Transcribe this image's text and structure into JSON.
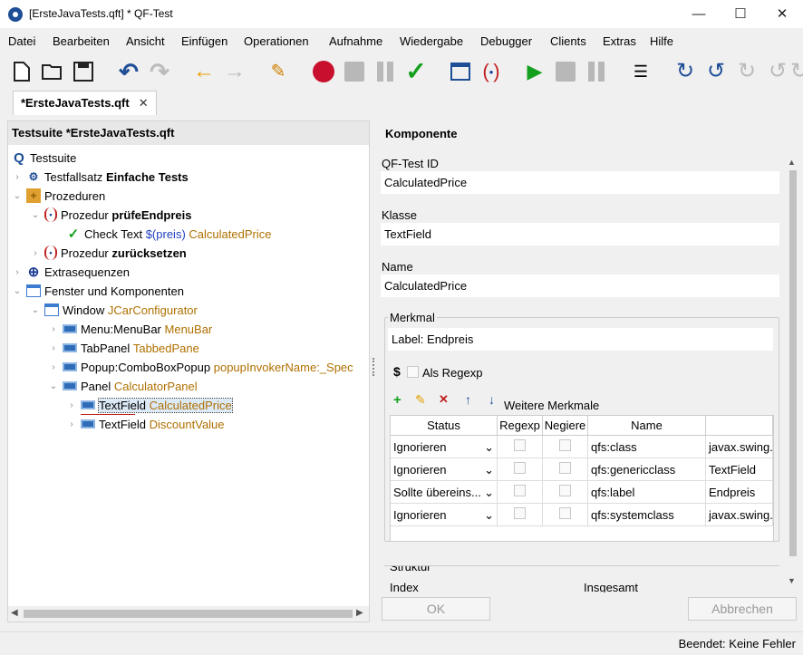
{
  "window": {
    "title": "[ErsteJavaTests.qft] * QF-Test",
    "minimize": "—",
    "maximize": "☐",
    "close": "✕"
  },
  "menu": [
    "Datei",
    "Bearbeiten",
    "Ansicht",
    "Einfügen",
    "Operationen",
    "Aufnahme",
    "Wiedergabe",
    "Debugger",
    "Clients",
    "Extras",
    "Hilfe"
  ],
  "toolbar": {
    "icons": [
      "new-file-icon",
      "open-folder-icon",
      "save-icon",
      "undo-icon",
      "redo-icon",
      "back-arrow-icon",
      "forward-arrow-icon",
      "wand-icon",
      "record-icon",
      "stop-icon",
      "pause-icon",
      "check-icon",
      "window-icon",
      "procedure-icon",
      "play-icon",
      "stop-icon",
      "pause-icon",
      "list-check-icon",
      "step-in-icon",
      "step-over-icon",
      "step-out-icon",
      "rerun-icon",
      "continue-icon"
    ]
  },
  "tab": {
    "label": "*ErsteJavaTests.qft",
    "close": "✕"
  },
  "tree": {
    "header": "Testsuite *ErsteJavaTests.qft",
    "nodes": [
      {
        "type": "Testsuite",
        "name": ""
      },
      {
        "type": "Testfallsatz",
        "name": "Einfache Tests"
      },
      {
        "type": "Prozeduren",
        "name": ""
      },
      {
        "type": "Prozedur",
        "name": "prüfeEndpreis"
      },
      {
        "type": "Check Text",
        "var": "$(preis)",
        "ref": "CalculatedPrice"
      },
      {
        "type": "Prozedur",
        "name": "zurücksetzen"
      },
      {
        "type": "Extrasequenzen",
        "name": ""
      },
      {
        "type": "Fenster und Komponenten",
        "name": ""
      },
      {
        "type": "Window",
        "ref": "JCarConfigurator"
      },
      {
        "type": "Menu:MenuBar",
        "ref": "MenuBar"
      },
      {
        "type": "TabPanel",
        "ref": "TabbedPane"
      },
      {
        "type": "Popup:ComboBoxPopup",
        "ref": "popupInvokerName:_Spec"
      },
      {
        "type": "Panel",
        "ref": "CalculatorPanel"
      },
      {
        "type": "TextField",
        "ref": "CalculatedPrice"
      },
      {
        "type": "TextField",
        "ref": "DiscountValue"
      }
    ]
  },
  "detail": {
    "title": "Komponente",
    "id_label": "QF-Test ID",
    "id_value": "CalculatedPrice",
    "class_label": "Klasse",
    "class_value": "TextField",
    "name_label": "Name",
    "name_value": "CalculatedPrice",
    "merkmal_label": "Merkmal",
    "merkmal_value": "Label: Endpreis",
    "regexp_label": "Als Regexp",
    "weitere_label": "Weitere Merkmale",
    "grid": {
      "headers": [
        "Status",
        "Regexp",
        "Negiere",
        "Name",
        ""
      ],
      "rows": [
        {
          "status": "Ignorieren",
          "name": "qfs:class",
          "value": "javax.swing."
        },
        {
          "status": "Ignorieren",
          "name": "qfs:genericclass",
          "value": "TextField"
        },
        {
          "status": "Sollte übereins...",
          "name": "qfs:label",
          "value": "Endpreis"
        },
        {
          "status": "Ignorieren",
          "name": "qfs:systemclass",
          "value": "javax.swing."
        }
      ]
    },
    "struktur_label": "Struktur",
    "index_label": "Index",
    "insgesamt_label": "Insgesamt",
    "ok": "OK",
    "cancel": "Abbrechen"
  },
  "status": "Beendet: Keine Fehler"
}
